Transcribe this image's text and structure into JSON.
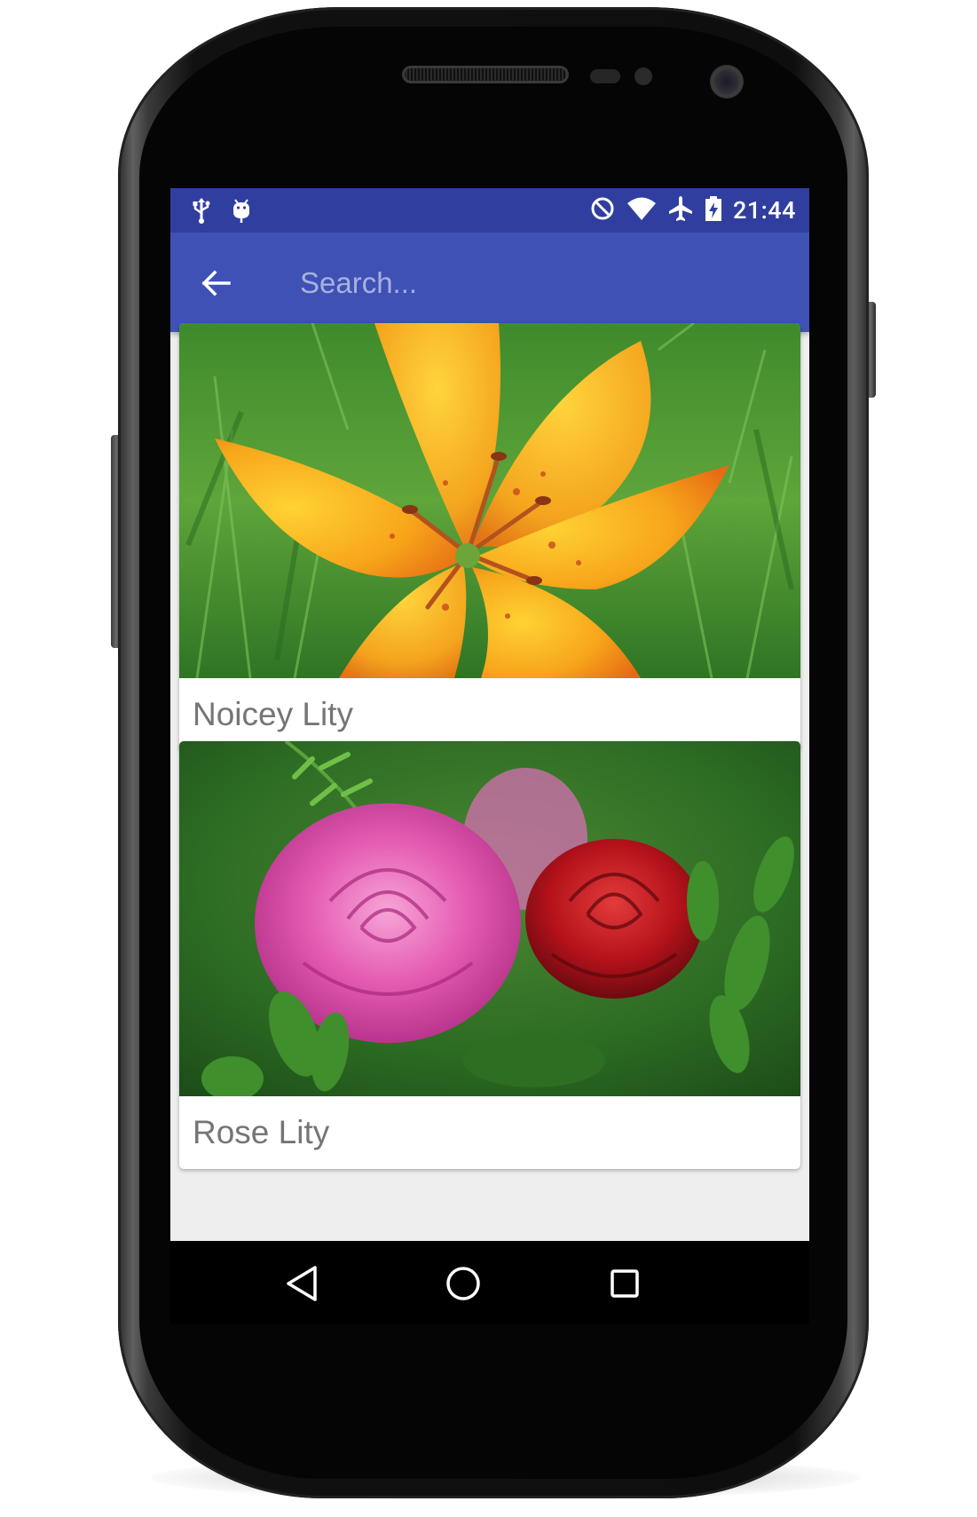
{
  "status_bar": {
    "time": "21:44",
    "left_icons": [
      "usb-icon",
      "android-debug-icon"
    ],
    "right_icons": [
      "do-not-disturb-icon",
      "wifi-icon",
      "airplane-mode-icon",
      "battery-charging-icon"
    ]
  },
  "toolbar": {
    "back_icon": "arrow-back-icon",
    "search_placeholder": "Search...",
    "search_value": ""
  },
  "cards": [
    {
      "title": "Noicey Lity",
      "image": "orange-lily-photo"
    },
    {
      "title": "Rose Lity",
      "image": "roses-photo"
    }
  ],
  "nav_bar": {
    "buttons": [
      "back-triangle-icon",
      "home-circle-icon",
      "recents-square-icon"
    ]
  },
  "colors": {
    "status_bar": "#303f9f",
    "toolbar": "#3f51b5",
    "background": "#eeeeee",
    "card_title_text": "#757575"
  }
}
